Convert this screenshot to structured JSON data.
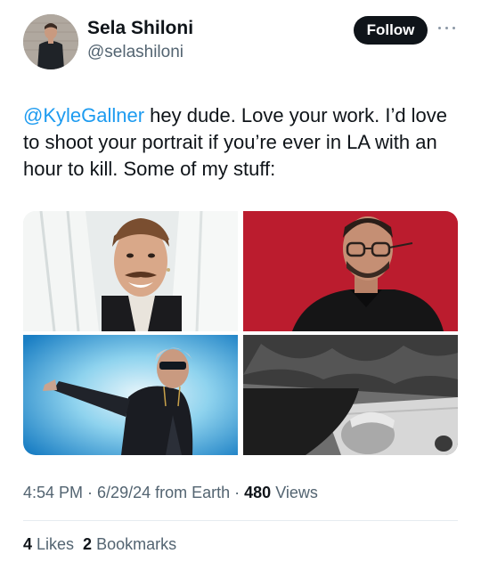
{
  "author": {
    "name": "Sela Shiloni",
    "handle": "@selashiloni"
  },
  "actions": {
    "follow_label": "Follow",
    "more_icon": "more-horizontal-icon"
  },
  "tweet": {
    "mention": "@KyleGallner",
    "text": " hey dude. Love your work. I’d love to shoot your portrait if you’re ever in LA with an hour to kill. Some of my stuff:"
  },
  "media": {
    "count": 4
  },
  "meta": {
    "time": "4:54 PM",
    "sep1": " · ",
    "date": "6/29/24",
    "source": " from Earth",
    "sep2": " · ",
    "views_count": "480",
    "views_label": " Views"
  },
  "stats": {
    "likes_count": "4",
    "likes_label": " Likes",
    "bookmarks_count": "2",
    "bookmarks_label": " Bookmarks"
  },
  "colors": {
    "accent": "#1d9bf0",
    "text": "#0f1419",
    "muted": "#536471",
    "button": "#0f1419"
  }
}
